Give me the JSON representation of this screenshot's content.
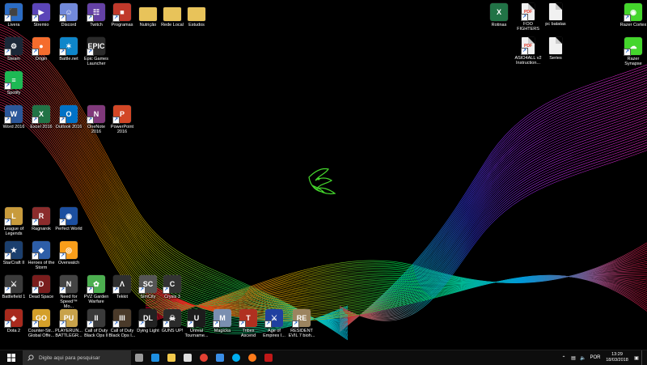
{
  "desktop": {
    "icons": [
      {
        "label": "Livera",
        "color": "#2b6cc4",
        "glyph": "⬛"
      },
      {
        "label": "Stremio",
        "color": "#5b45b8",
        "glyph": "▶"
      },
      {
        "label": "Discord",
        "color": "#7289da",
        "glyph": "☺"
      },
      {
        "label": "Twitch",
        "color": "#6441a5",
        "glyph": "☷"
      },
      {
        "label": "Programas",
        "color": "#c0392b",
        "glyph": "■"
      },
      {
        "label": "Nutrição",
        "color": "#e8c35a",
        "glyph": ""
      },
      {
        "label": "Rede Local",
        "color": "#e8c35a",
        "glyph": ""
      },
      {
        "label": "Estudos",
        "color": "#e8c35a",
        "glyph": ""
      },
      {
        "label": "Steam",
        "color": "#1b2838",
        "glyph": "⚙"
      },
      {
        "label": "Origin",
        "color": "#f56c2d",
        "glyph": "●"
      },
      {
        "label": "Battle.net",
        "color": "#0e86ca",
        "glyph": "✶"
      },
      {
        "label": "Epic Games\nLauncher",
        "color": "#2a2a2a",
        "glyph": "EPIC"
      },
      {
        "label": "Spotify",
        "color": "#1db954",
        "glyph": "≡"
      },
      {
        "label": "Word 2016",
        "color": "#2b579a",
        "glyph": "W"
      },
      {
        "label": "Excel 2016",
        "color": "#217346",
        "glyph": "X"
      },
      {
        "label": "Outlook 2016",
        "color": "#0072c6",
        "glyph": "O"
      },
      {
        "label": "OneNote\n2016",
        "color": "#80397b",
        "glyph": "N"
      },
      {
        "label": "PowerPoint\n2016",
        "color": "#d24726",
        "glyph": "P"
      },
      {
        "label": "League of\nLegends",
        "color": "#c89b3c",
        "glyph": "L"
      },
      {
        "label": "Ragnarok",
        "color": "#8b2c2c",
        "glyph": "R"
      },
      {
        "label": "Perfect World",
        "color": "#1c4fa0",
        "glyph": "◉"
      },
      {
        "label": "StarCraft II",
        "color": "#1b3f6e",
        "glyph": "★"
      },
      {
        "label": "Heroes of the\nStorm",
        "color": "#2d5ea8",
        "glyph": "◆"
      },
      {
        "label": "Overwatch",
        "color": "#f99e1a",
        "glyph": "◎"
      },
      {
        "label": "Battlefield 1",
        "color": "#3b3b3b",
        "glyph": "⚔"
      },
      {
        "label": "Dead Space",
        "color": "#7a1d1d",
        "glyph": "D"
      },
      {
        "label": "Need for\nSpeed™ Mo...",
        "color": "#444",
        "glyph": "N"
      },
      {
        "label": "PVZ Garden\nWarfare",
        "color": "#4caf50",
        "glyph": "✿"
      },
      {
        "label": "Tekkit",
        "color": "#2f2f2f",
        "glyph": "Λ"
      },
      {
        "label": "SimCity",
        "color": "#555",
        "glyph": "SC"
      },
      {
        "label": "Crysis 3",
        "color": "#333",
        "glyph": "C"
      },
      {
        "label": "Dota 2",
        "color": "#a82a1d",
        "glyph": "◈"
      },
      {
        "label": "Counter-Str...\nGlobal Offe...",
        "color": "#d49f29",
        "glyph": "GO"
      },
      {
        "label": "PLAYERUN...\nBATTLEGR...",
        "color": "#c8a24a",
        "glyph": "PU"
      },
      {
        "label": "Call of Duty\nBlack Ops II",
        "color": "#3a3a3a",
        "glyph": "II"
      },
      {
        "label": "Call of Duty\nBlack Ops I...",
        "color": "#4a3a2a",
        "glyph": "III"
      },
      {
        "label": "Dying Light",
        "color": "#222",
        "glyph": "DL"
      },
      {
        "label": "GUNS UP!",
        "color": "#2b2b2b",
        "glyph": "☠"
      },
      {
        "label": "Unreal\nTourname...",
        "color": "#1c1c1c",
        "glyph": "U"
      },
      {
        "label": "Magicka",
        "color": "#7a8fb0",
        "glyph": "M"
      },
      {
        "label": "Tribes\nAscend",
        "color": "#b03020",
        "glyph": "T"
      },
      {
        "label": "Age of\nEmpires I...",
        "color": "#2040a0",
        "glyph": "⚔"
      },
      {
        "label": "RESIDENT\nEVIL 7 bioh...",
        "color": "#9c8460",
        "glyph": "RE"
      },
      {
        "label": "Rotinas",
        "color": "#217346",
        "glyph": "X"
      },
      {
        "label": "FOO\nFIGHTERS",
        "color": "#f1f1f1",
        "glyph": "PDF"
      },
      {
        "label": "pc batatas",
        "color": "#f1f1f1",
        "glyph": ""
      },
      {
        "label": "Razer Cortex",
        "color": "#44d62c",
        "glyph": "◉"
      },
      {
        "label": "ASIO4ALL v2\nInstruction...",
        "color": "#f1f1f1",
        "glyph": "PDF"
      },
      {
        "label": "Series",
        "color": "#f1f1f1",
        "glyph": ""
      },
      {
        "label": "Razer\nSynapse",
        "color": "#44d62c",
        "glyph": "☁"
      }
    ]
  },
  "taskbar": {
    "start_icon": "windows-logo-icon",
    "search_placeholder": "Digite aqui para pesquisar",
    "pinned": [
      {
        "name": "task-view-icon",
        "color": "#9a9a9a"
      },
      {
        "name": "edge-icon",
        "color": "#1e8fe1"
      },
      {
        "name": "file-explorer-icon",
        "color": "#f2c94c"
      },
      {
        "name": "store-icon",
        "color": "#dddddd"
      },
      {
        "name": "chrome-icon",
        "color": "#e34133"
      },
      {
        "name": "mail-icon",
        "color": "#3a8ee6"
      },
      {
        "name": "skype-icon",
        "color": "#00aff0"
      },
      {
        "name": "firefox-icon",
        "color": "#ff7a1a"
      },
      {
        "name": "mcafee-icon",
        "color": "#c01818"
      }
    ],
    "tray": {
      "language": "POR",
      "time": "13:29",
      "date": "18/03/2018"
    }
  },
  "wallpaper": {
    "logo": "razer-logo-icon",
    "accent": "#44d62c"
  }
}
